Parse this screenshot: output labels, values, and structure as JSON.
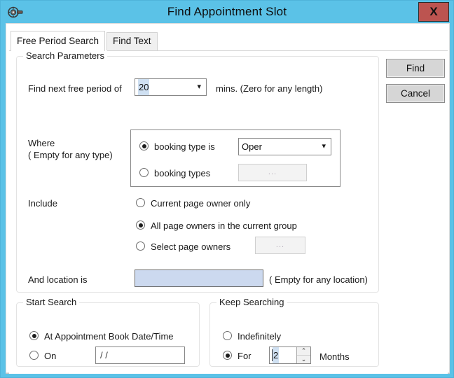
{
  "window": {
    "title": "Find Appointment Slot",
    "icon": "find-appointment-icon",
    "close_label": "X",
    "titlebar_color": "#5bc2e7",
    "close_color": "#bc5450"
  },
  "tabs": [
    {
      "label": "Free Period Search",
      "active": true
    },
    {
      "label": "Find Text",
      "active": false
    }
  ],
  "action_buttons": {
    "find_label": "Find",
    "cancel_label": "Cancel"
  },
  "search_parameters": {
    "legend": "Search Parameters",
    "period": {
      "prefix_label": "Find next free period of",
      "value": "20",
      "suffix_label": "mins. (Zero for any length)",
      "chevron": "chevron-down-icon"
    },
    "where": {
      "label_line1": "Where",
      "label_line2": "( Empty for any type)",
      "options": [
        {
          "label": "booking type is",
          "checked": true
        },
        {
          "label": "booking types",
          "checked": false
        }
      ],
      "booking_type_value": "Oper",
      "booking_type_chevron": "chevron-down-icon",
      "booking_types_button": "..."
    },
    "include": {
      "label": "Include",
      "options": [
        {
          "label": "Current page owner only",
          "checked": false
        },
        {
          "label": "All page owners in the current group",
          "checked": true
        },
        {
          "label": "Select page owners",
          "checked": false
        }
      ],
      "select_owners_button": "..."
    },
    "location": {
      "label": "And location is",
      "value": "",
      "hint": "( Empty for any location)",
      "field_color": "#ccd9ef"
    }
  },
  "start_search": {
    "legend": "Start Search",
    "options": [
      {
        "label": "At Appointment Book Date/Time",
        "checked": true
      },
      {
        "label": "On",
        "checked": false
      }
    ],
    "date_value": "/ /"
  },
  "keep_searching": {
    "legend": "Keep Searching",
    "options": [
      {
        "label": "Indefinitely",
        "checked": false
      },
      {
        "label": "For",
        "checked": true
      }
    ],
    "months_value": "2",
    "months_label": "Months",
    "spin_up": "⌃",
    "spin_down": "⌄"
  }
}
